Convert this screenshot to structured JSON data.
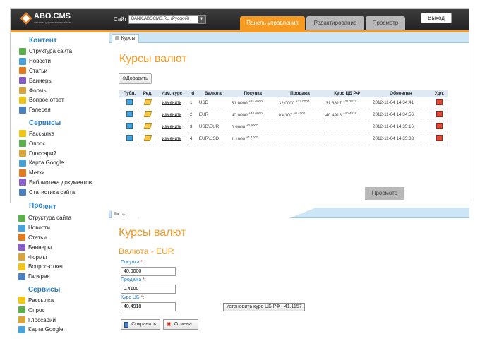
{
  "app": {
    "logo_text": "ABO.CMS",
    "logo_sub": "система управления сайтом"
  },
  "header": {
    "site_label": "Сайт",
    "site_value": "BANK.ABOCMS.RU (Русский)",
    "tabs": [
      "Панель управления",
      "Редактирование",
      "Просмотр"
    ],
    "exit_label": "Выход"
  },
  "sidebar": {
    "content_title": "Контент",
    "content_items": [
      "Структура сайта",
      "Новости",
      "Статьи",
      "Баннеры",
      "Формы",
      "Вопрос-ответ",
      "Галерея"
    ],
    "services_title": "Сервисы",
    "services_items": [
      "Рассылка",
      "Опрос",
      "Глоссарий",
      "Карта Google",
      "Метки",
      "Библиотека документов",
      "Статистика сайта"
    ]
  },
  "main": {
    "breadcrumb": "Курсы",
    "title": "Курсы валют",
    "add_label": "Добавить",
    "columns": [
      "Публ.",
      "Ред.",
      "Изм. курс",
      "Id",
      "Валюта",
      "Покупка",
      "Продажа",
      "Курс ЦБ РФ",
      "Обновлен",
      "Удл."
    ],
    "rows": [
      {
        "link": "изменить",
        "id": "1",
        "currency": "USD",
        "buy": "31.0000",
        "buy_sup": "+31.0000",
        "sell": "32.0000",
        "sell_sup": "+32.0000",
        "cbr": "31.3817",
        "cbr_sup": "+31.3817",
        "updated": "2012-11-04 14:34:41"
      },
      {
        "link": "изменить",
        "id": "2",
        "currency": "EUR",
        "buy": "40.0000",
        "buy_sup": "+40.0000",
        "sell": "0.4100",
        "sell_sup": "+0.4100",
        "cbr": "40.4918",
        "cbr_sup": "+40.4918",
        "updated": "2012-11-04 14:34:56"
      },
      {
        "link": "изменить",
        "id": "3",
        "currency": "USD\\EUR",
        "buy": "0.9000",
        "buy_sup": "+0.9000",
        "sell": "",
        "sell_sup": "",
        "cbr": "",
        "cbr_sup": "",
        "updated": "2012-11-04 14:35:16"
      },
      {
        "link": "изменить",
        "id": "4",
        "currency": "EUR\\USD",
        "buy": "1.1000",
        "buy_sup": "+1.1000",
        "sell": "",
        "sell_sup": "",
        "cbr": "",
        "cbr_sup": "",
        "updated": "2012-11-04 14:35:33"
      }
    ]
  },
  "overlay": {
    "tab": "Просмотр",
    "breadcrumb": "Курсы",
    "title": "Курсы валют",
    "subtitle": "Валюта - EUR",
    "fields": [
      {
        "label": "Покупка",
        "value": "40.0000"
      },
      {
        "label": "Продажа",
        "value": "0.4100"
      },
      {
        "label": "Курс ЦБ",
        "value": "40.4918"
      }
    ],
    "cbr_button": "Установить курс ЦБ РФ - 41.1157",
    "save_label": "Сохранить",
    "cancel_label": "Отмена",
    "sidebar_partial_title": "Про",
    "content_title": "Контент",
    "content_items": [
      "Структура сайта",
      "Новости",
      "Статьи",
      "Баннеры",
      "Формы",
      "Вопрос-ответ",
      "Галерея"
    ],
    "services_title": "Сервисы",
    "services_items": [
      "Рассылка",
      "Опрос",
      "Глоссарий",
      "Карта Google"
    ]
  },
  "icon_colors": [
    "#4aa3d8",
    "#e27b1f",
    "#5cae4f",
    "#d9a43b",
    "#8a5fc9",
    "#f0c419",
    "#4a7fc0"
  ]
}
